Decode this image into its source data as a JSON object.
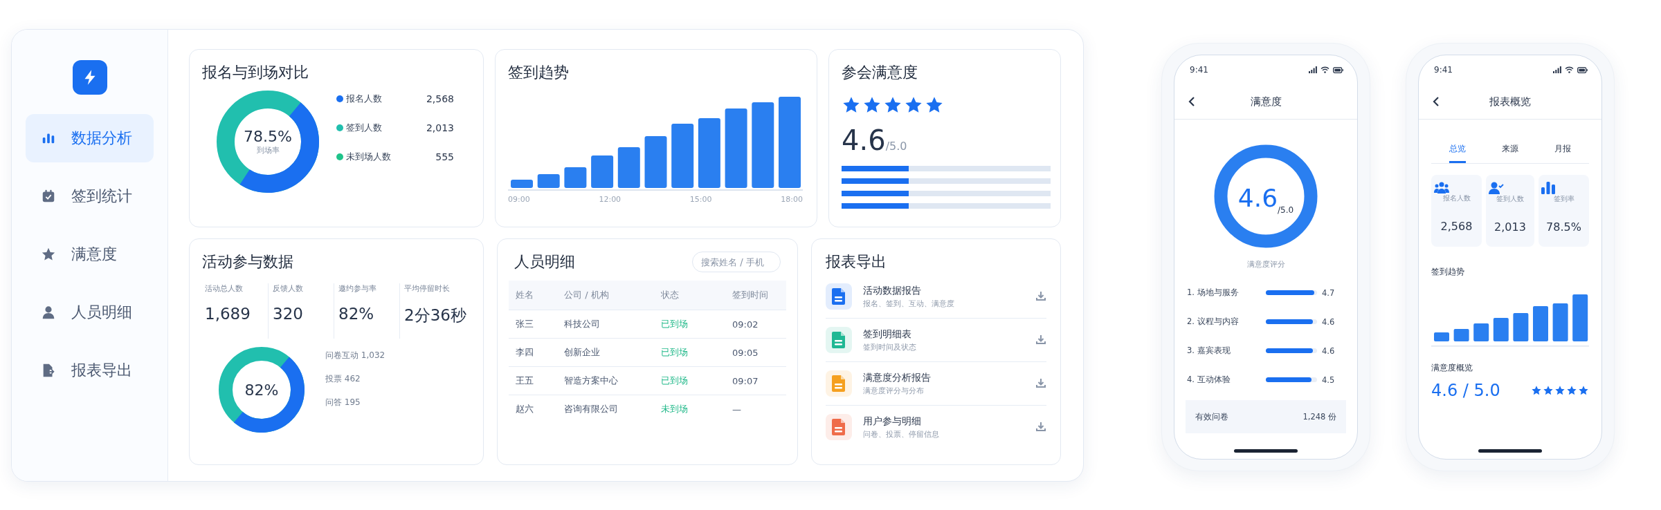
{
  "sidebar": {
    "items": [
      {
        "label": "数据分析",
        "selected": true
      },
      {
        "label": "签到统计",
        "selected": false
      },
      {
        "label": "满意度",
        "selected": false
      },
      {
        "label": "人员明细",
        "selected": false
      },
      {
        "label": "报表导出",
        "selected": false
      }
    ]
  },
  "registration_card": {
    "title": "报名与到场对比",
    "donut": {
      "value": "78.5%",
      "caption": "到场率",
      "level": 0.48
    },
    "legend": [
      {
        "label": "报名人数",
        "value": "2,568",
        "color": "#1a6ff0"
      },
      {
        "label": "签到人数",
        "value": "2,013",
        "color": "#21bfae"
      },
      {
        "label": "未到场人数",
        "value": "555",
        "color": "#1fc38a"
      }
    ]
  },
  "trend_card": {
    "title": "签到趋势",
    "x_labels": [
      "09:00",
      "12:00",
      "15:00",
      "18:00"
    ]
  },
  "satisfaction_card": {
    "title": "参会满意度",
    "stars": 5,
    "score": "4.6",
    "max": "/5.0",
    "bars": [
      {
        "level": 0.32
      },
      {
        "level": 0.32
      },
      {
        "level": 0.32
      },
      {
        "level": 0.32
      }
    ]
  },
  "participation_card": {
    "title": "活动参与数据",
    "stats": [
      {
        "label": "活动总人数",
        "value": "1,689"
      },
      {
        "label": "反馈人数",
        "value": "320"
      },
      {
        "label": "邀约参与率",
        "value": "82%"
      },
      {
        "label": "平均停留时长",
        "value": "2分36秒"
      }
    ],
    "donut": {
      "value": "82%",
      "level": 0.5
    },
    "legend": [
      "问卷互动 1,032",
      "投票 462",
      "问答 195"
    ]
  },
  "people_card": {
    "title": "人员明细",
    "search": {
      "placeholder": "搜索姓名 / 手机"
    },
    "columns": [
      "姓名",
      "公司 / 机构",
      "状态",
      "签到时间"
    ],
    "rows": [
      [
        "张三",
        "科技公司",
        "已到场",
        "09:02"
      ],
      [
        "李四",
        "创新企业",
        "已到场",
        "09:05"
      ],
      [
        "王五",
        "智造方案中心",
        "已到场",
        "09:07"
      ],
      [
        "赵六",
        "咨询有限公司",
        "未到场",
        "—"
      ]
    ]
  },
  "export_card": {
    "title": "报表导出",
    "items": [
      {
        "title": "活动数据报告",
        "subtitle": "报名、签到、互动、满意度",
        "color": "#1a6ff0"
      },
      {
        "title": "签到明细表",
        "subtitle": "签到时间及状态",
        "color": "#1fb894"
      },
      {
        "title": "满意度分析报告",
        "subtitle": "满意度评分与分布",
        "color": "#f5a01f"
      },
      {
        "title": "用户参与明细",
        "subtitle": "问卷、投票、停留信息",
        "color": "#ef6c4a"
      }
    ]
  },
  "phone_satisfaction": {
    "time": "9:41",
    "title": "满意度",
    "score": "4.6",
    "max": "/5.0",
    "caption": "满意度评分",
    "items": [
      {
        "label": "1. 场地与服务",
        "level": 0.94,
        "value": "4.7"
      },
      {
        "label": "2. 议程与内容",
        "level": 0.92,
        "value": "4.6"
      },
      {
        "label": "3. 嘉宾表现",
        "level": 0.92,
        "value": "4.6"
      },
      {
        "label": "4. 互动体验",
        "level": 0.89,
        "value": "4.5"
      }
    ],
    "summary": {
      "label": "有效问卷",
      "value": "1,248 份"
    }
  },
  "phone_overview": {
    "time": "9:41",
    "title": "报表概览",
    "tabs": [
      {
        "label": "总览",
        "selected": true
      },
      {
        "label": "来源",
        "selected": false
      },
      {
        "label": "月报",
        "selected": false
      }
    ],
    "stats": [
      {
        "kind": "people",
        "label": "报名人数",
        "value": "2,568"
      },
      {
        "kind": "checkin",
        "label": "签到人数",
        "value": "2,013"
      },
      {
        "kind": "rate",
        "label": "签到率",
        "value": "78.5%"
      }
    ],
    "chart_title": "签到趋势",
    "rating_title": "满意度概览",
    "rating": "4.6 / 5.0",
    "stars": 5
  }
}
